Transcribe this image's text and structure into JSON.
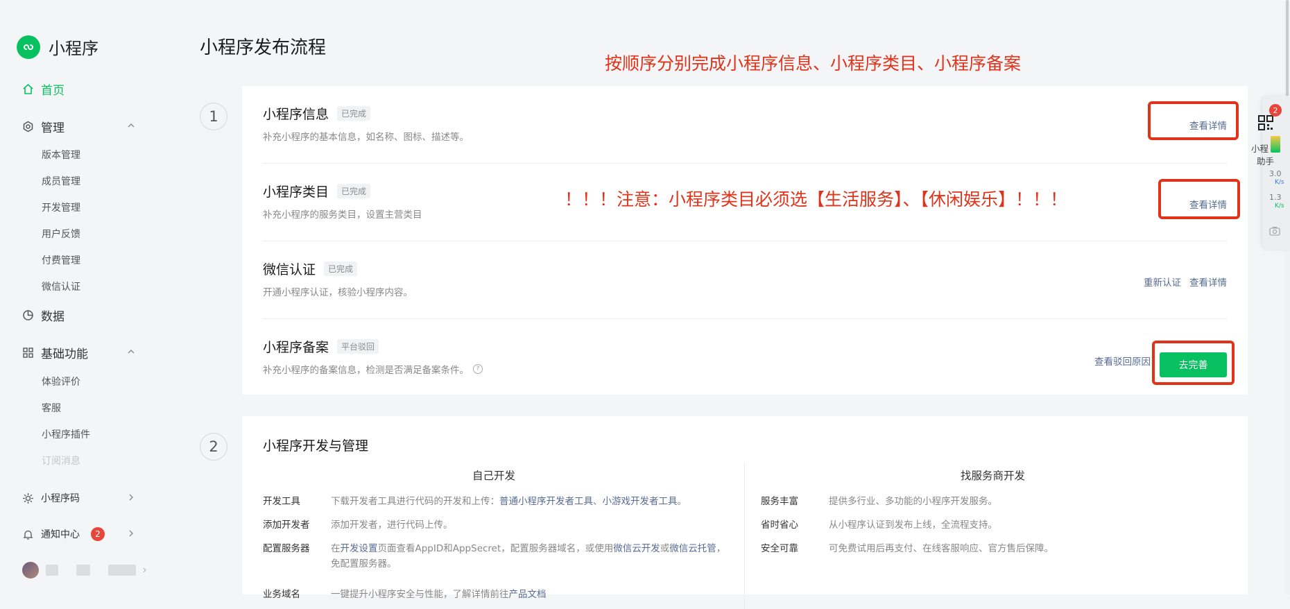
{
  "colors": {
    "brand": "#07c160",
    "annotation": "#e0331a",
    "link": "#576b95",
    "badge": "#e8453c"
  },
  "sidebar": {
    "app_name": "小程序",
    "home": "首页",
    "manage": "管理",
    "manage_items": [
      "版本管理",
      "成员管理",
      "开发管理",
      "用户反馈",
      "付费管理",
      "微信认证"
    ],
    "data": "数据",
    "basic": "基础功能",
    "basic_items": [
      "体验评价",
      "客服",
      "小程序插件",
      "订阅消息"
    ],
    "qrcode": "小程序码",
    "notify": "通知中心",
    "notify_count": "2"
  },
  "main": {
    "title": "小程序发布流程",
    "annotation_top": "按顺序分别完成小程序信息、小程序类目、小程序备案",
    "annotation_mid": "！！！注意：小程序类目必须选【生活服务】、【休闲娱乐】！！！",
    "step1_num": "1",
    "step2_num": "2",
    "rows": [
      {
        "title": "小程序信息",
        "tag": "已完成",
        "desc": "补充小程序的基本信息，如名称、图标、描述等。",
        "action": "查看详情"
      },
      {
        "title": "小程序类目",
        "tag": "已完成",
        "desc": "补充小程序的服务类目，设置主营类目",
        "action": "查看详情"
      },
      {
        "title": "微信认证",
        "tag": "已完成",
        "desc": "开通小程序认证，核验小程序内容。",
        "action_secondary": "重新认证",
        "action": "查看详情"
      },
      {
        "title": "小程序备案",
        "tag": "平台驳回",
        "desc": "补充小程序的备案信息，检测是否满足备案条件。",
        "action_secondary": "查看驳回原因",
        "button": "去完善"
      }
    ],
    "section2": {
      "title": "小程序开发与管理",
      "left_head": "自己开发",
      "right_head": "找服务商开发",
      "left": [
        {
          "label": "开发工具",
          "text": "下载开发者工具进行代码的开发和上传：",
          "link1": "普通小程序开发者工具",
          "sep": "、",
          "link2": "小游戏开发者工具",
          "end": "。"
        },
        {
          "label": "添加开发者",
          "text": "添加开发者，进行代码上传。"
        },
        {
          "label": "配置服务器",
          "pre": "在",
          "link1": "开发设置",
          "mid1": "页面查看AppID和AppSecret，配置服务器域名，或使用",
          "link2": "微信云开发",
          "mid2": "或",
          "link3": "微信云托管",
          "end": "，免配置服务器。"
        },
        {
          "label": "业务域名",
          "text": "一键提升小程序安全与性能，了解详情前往",
          "link": "产品文档"
        }
      ],
      "right": [
        {
          "label": "服务丰富",
          "text": "提供多行业、多功能的小程序开发服务。"
        },
        {
          "label": "省时省心",
          "text": "从小程序认证到发布上线，全流程支持。"
        },
        {
          "label": "安全可靠",
          "text": "可免费试用后再支付、在线客服响应、官方售后保障。"
        }
      ]
    }
  },
  "assistant": {
    "badge": "2",
    "line1": "小程",
    "line2": "助手",
    "speed_up": "3.0",
    "speed_up_unit": "K/s",
    "speed_down": "1.3",
    "speed_down_unit": "K/s"
  }
}
